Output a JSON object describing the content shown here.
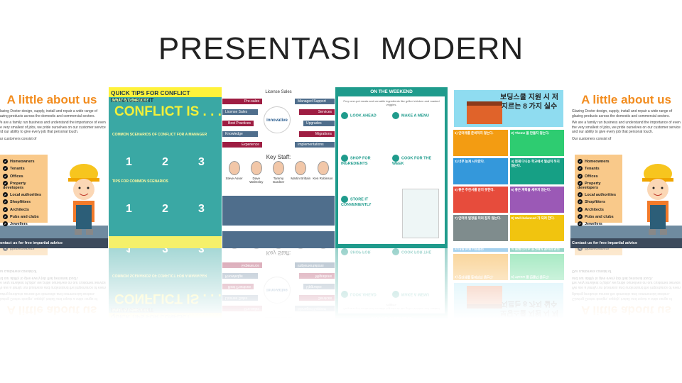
{
  "title": "PRESENTASI  MODERN",
  "about": {
    "heading": "A little about us",
    "para1": "Glazing Doctor design, supply, install and repair a wide range of glazing products across the domestic and commercial sectors.",
    "para2": "We are a family run business and understand the importance of even the very smallest of jobs, we pride ourselves on our customer service and our ability to give every job that personal touch.",
    "para3": "Our customers consist of",
    "customers": [
      "Homeowners",
      "Tenants",
      "Offices",
      "Property developers",
      "Local authorities",
      "Shopfitters",
      "Architects",
      "Pubs and clubs",
      "Jewellers"
    ],
    "footer": "Contact us for free impartial advice",
    "accent": "#f28c1e"
  },
  "conflict": {
    "heading": "QUICK TIPS FOR CONFLICT MANAGEMENT",
    "what": "WHAT IS CONFLICT?",
    "big": "CONFLICT IS . . .",
    "scenarios": "COMMON SCENARIOS OF CONFLICT FOR A MANAGER",
    "tips": "TIPS FOR COMMON SCENARIOS",
    "nums": [
      "1",
      "2",
      "3"
    ]
  },
  "license": {
    "title": "License Sales",
    "left": [
      "Pre-sales",
      "License Sales",
      "Best Practices",
      "Knowledge",
      "Experience"
    ],
    "right": [
      "Managed Support",
      "Services",
      "Upgrades",
      "Migrations",
      "Implementations"
    ],
    "logo": "innovative",
    "key_staff": "Key Staff:",
    "staff": [
      "Steve Asser",
      "Dave Walmsley",
      "Tammy Gardner",
      "Martin Brittain",
      "Ken Robinson"
    ]
  },
  "weekend": {
    "heading": "ON THE WEEKEND",
    "intro": "Prep one-pot meals and versatile ingredients like grilled chicken and roasted veggies.",
    "steps": [
      "LOOK AHEAD",
      "MAKE A MENU",
      "SHOP FOR INGREDIENTS",
      "COOK FOR THE WEEK",
      "STORE IT CONVENIENTLY"
    ]
  },
  "korean": {
    "heading": "보딩스쿨 지원 시 저지르는 8 가지 실수",
    "cards": [
      {
        "label": "1) 인터뷰를 준비하지 않는다.",
        "color": "#f39c12"
      },
      {
        "label": "2) Theme 을 만들지 않는다.",
        "color": "#2ecc71"
      },
      {
        "label": "3) 너무 늦게 시작한다.",
        "color": "#3498db"
      },
      {
        "label": "4) 현재 다니는 학교에서 열심히 하지 않는다.",
        "color": "#16a085"
      },
      {
        "label": "5) 좋은 추천서를 받지 못한다.",
        "color": "#e74c3c"
      },
      {
        "label": "6) 좋은 계획을 세우지 않는다.",
        "color": "#9b59b6"
      },
      {
        "label": "7) 인터뷰 일정을 미리 잡지 않는다.",
        "color": "#7f8c8d"
      },
      {
        "label": "8) Well-balanced 가 되려 한다.",
        "color": "#f1c40f"
      }
    ]
  }
}
